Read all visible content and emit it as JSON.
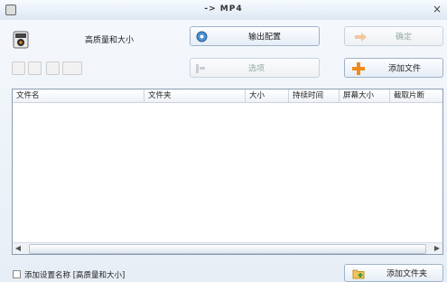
{
  "window": {
    "title": "-> MP4"
  },
  "profile": {
    "label": "高质量和大小"
  },
  "buttons": {
    "output_config": "输出配置",
    "ok": "确定",
    "options": "选项",
    "add_file": "添加文件",
    "add_folder": "添加文件夹"
  },
  "table": {
    "columns": [
      "文件名",
      "文件夹",
      "大小",
      "持续时间",
      "屏幕大小",
      "截取片断"
    ]
  },
  "footer": {
    "checkbox_label": "添加设置名称 [高质量和大小]"
  },
  "colors": {
    "accent_orange": "#f08a1c",
    "table_border": "#8b9bb0"
  }
}
